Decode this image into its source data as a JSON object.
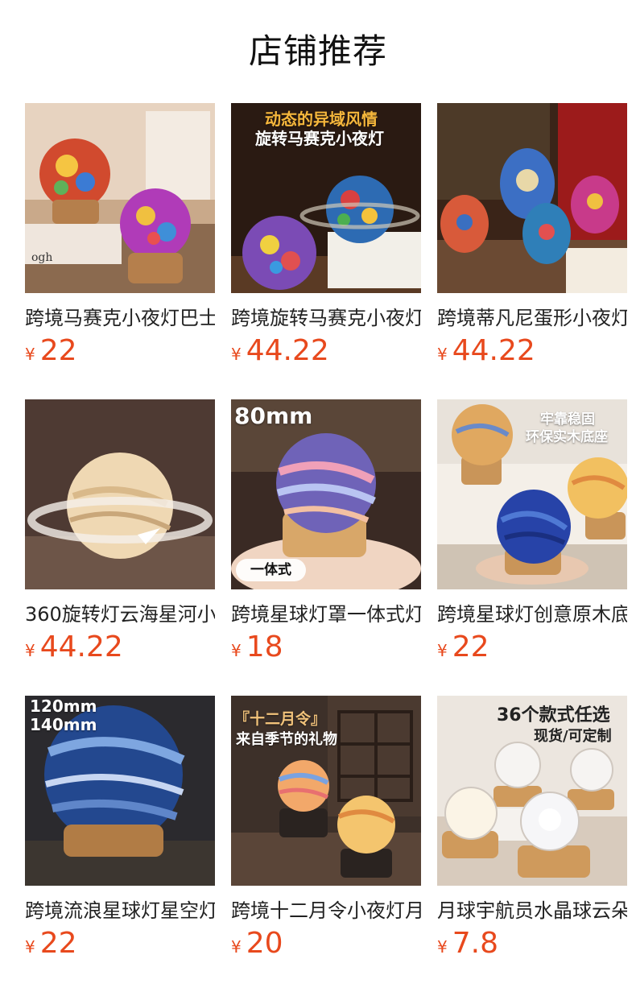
{
  "page": {
    "title": "店铺推荐"
  },
  "currency": "¥",
  "products": [
    {
      "name": "跨境马赛克小夜灯巴士",
      "price": "22",
      "overlay": []
    },
    {
      "name": "跨境旋转马赛克小夜灯",
      "price": "44.22",
      "overlay": [
        "动态的异域风情",
        "旋转马赛克小夜灯"
      ]
    },
    {
      "name": "跨境蒂凡尼蛋形小夜灯",
      "price": "44.22",
      "overlay": []
    },
    {
      "name": "360旋转灯云海星河小",
      "price": "44.22",
      "overlay": []
    },
    {
      "name": "跨境星球灯罩一体式灯",
      "price": "18",
      "overlay": [
        "80mm",
        "一体式"
      ]
    },
    {
      "name": "跨境星球灯创意原木底",
      "price": "22",
      "overlay": [
        "牢靠稳固",
        "环保实木底座"
      ]
    },
    {
      "name": "跨境流浪星球灯星空灯",
      "price": "22",
      "overlay": [
        "120mm",
        "140mm"
      ]
    },
    {
      "name": "跨境十二月令小夜灯月",
      "price": "20",
      "overlay": [
        "『十二月令』",
        "来自季节的礼物"
      ]
    },
    {
      "name": "月球宇航员水晶球云朵",
      "price": "7.8",
      "overlay": [
        "36个款式任选",
        "现货/可定制"
      ]
    }
  ]
}
